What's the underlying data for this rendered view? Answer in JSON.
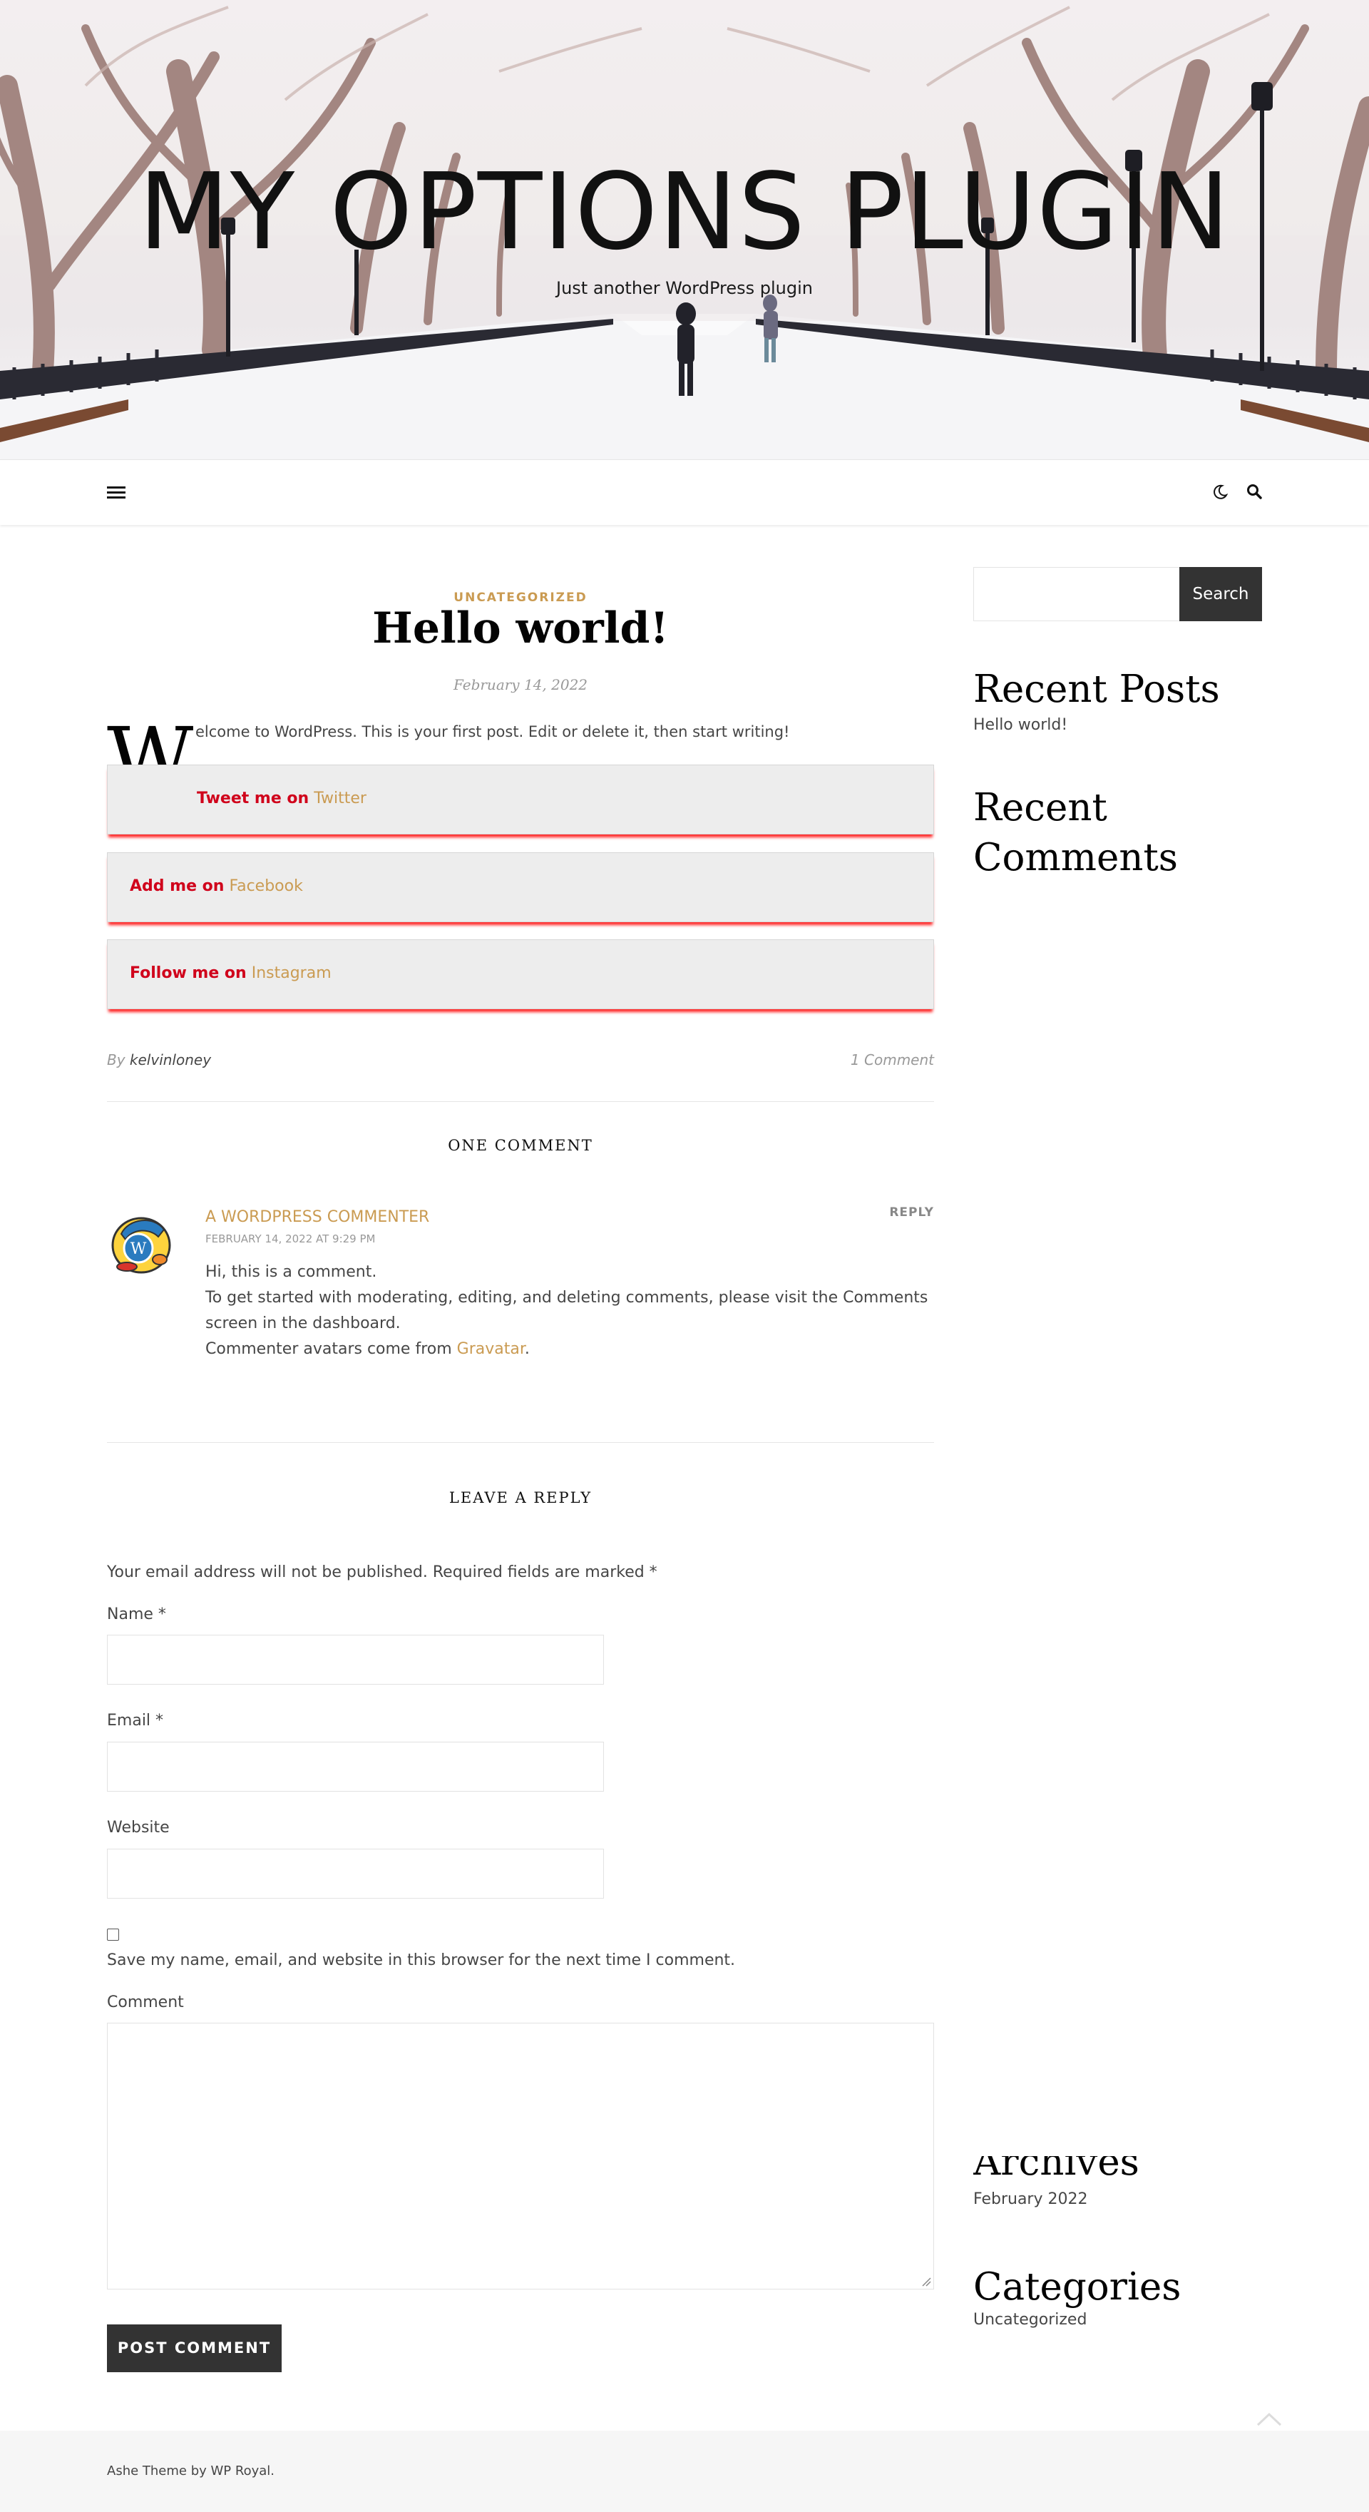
{
  "header": {
    "site_title": "MY OPTIONS PLUGIN",
    "tagline": "Just another WordPress plugin"
  },
  "navbar": {
    "menu_icon": "hamburger-menu-icon",
    "dark_mode_icon": "moon-icon",
    "search_icon": "search-icon"
  },
  "post": {
    "category": "UNCATEGORIZED",
    "title": "Hello world!",
    "date": "February 14, 2022",
    "dropcap": "W",
    "intro": "elcome to WordPress. This is your first post. Edit or delete it, then start writing!",
    "social": [
      {
        "lead": "Tweet me on",
        "link": "Twitter"
      },
      {
        "lead": "Add me on",
        "link": "Facebook"
      },
      {
        "lead": "Follow me on",
        "link": "Instagram"
      }
    ],
    "by_label": "By",
    "author": "kelvinloney",
    "comments_count": "1 Comment"
  },
  "comments": {
    "heading": "ONE COMMENT",
    "items": [
      {
        "author": "A WORDPRESS COMMENTER",
        "date": "FEBRUARY 14, 2022 AT 9:29 PM",
        "reply": "REPLY",
        "line1": "Hi, this is a comment.",
        "line2": "To get started with moderating, editing, and deleting comments, please visit the Comments",
        "line3": "screen in the dashboard.",
        "line4_pre": "Commenter avatars come from",
        "line4_link": "Gravatar",
        "line4_post": "."
      }
    ]
  },
  "reply_form": {
    "heading": "LEAVE A REPLY",
    "notice": "Your email address will not be published. Required fields are marked *",
    "name_label": "Name *",
    "email_label": "Email *",
    "website_label": "Website",
    "save_label": "Save my name, email, and website in this browser for the next time I comment.",
    "comment_label": "Comment",
    "submit_label": "POST COMMENT"
  },
  "sidebar": {
    "search_button": "Search",
    "recent_posts_title": "Recent Posts",
    "recent_posts": [
      "Hello world!"
    ],
    "recent_comments_title": "Recent Comments",
    "archives_title": "Archives",
    "archives": [
      "February 2022"
    ],
    "categories_title": "Categories",
    "categories": [
      "Uncategorized"
    ]
  },
  "footer": {
    "credit": "Ashe Theme by WP Royal."
  },
  "colors": {
    "accent": "#ca9b52",
    "social_lead": "#d0021b",
    "button_bg": "#333333"
  }
}
